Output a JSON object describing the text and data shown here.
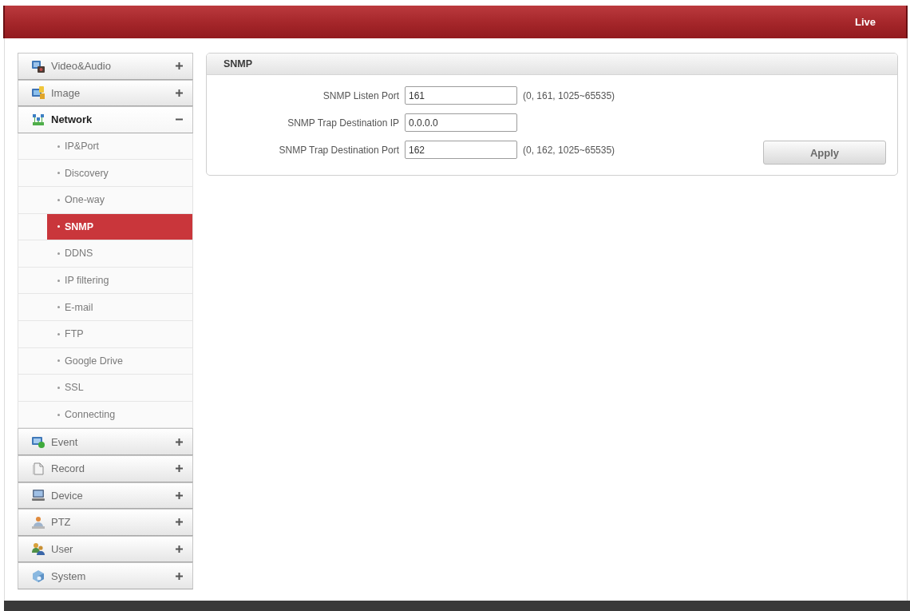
{
  "header": {
    "live_link": "Live"
  },
  "sidebar": {
    "items": [
      {
        "label": "Video&Audio",
        "selected": false,
        "expanded": false
      },
      {
        "label": "Image",
        "selected": false,
        "expanded": false
      },
      {
        "label": "Network",
        "selected": true,
        "expanded": true,
        "children": [
          {
            "label": "IP&Port",
            "selected": false
          },
          {
            "label": "Discovery",
            "selected": false
          },
          {
            "label": "One-way",
            "selected": false
          },
          {
            "label": "SNMP",
            "selected": true
          },
          {
            "label": "DDNS",
            "selected": false
          },
          {
            "label": "IP filtering",
            "selected": false
          },
          {
            "label": "E-mail",
            "selected": false
          },
          {
            "label": "FTP",
            "selected": false
          },
          {
            "label": "Google Drive",
            "selected": false
          },
          {
            "label": "SSL",
            "selected": false
          },
          {
            "label": "Connecting",
            "selected": false
          }
        ]
      },
      {
        "label": "Event",
        "selected": false,
        "expanded": false
      },
      {
        "label": "Record",
        "selected": false,
        "expanded": false
      },
      {
        "label": "Device",
        "selected": false,
        "expanded": false
      },
      {
        "label": "PTZ",
        "selected": false,
        "expanded": false
      },
      {
        "label": "User",
        "selected": false,
        "expanded": false
      },
      {
        "label": "System",
        "selected": false,
        "expanded": false
      }
    ]
  },
  "panel": {
    "title": "SNMP",
    "fields": [
      {
        "label": "SNMP Listen Port",
        "value": "161",
        "hint": "(0, 161, 1025~65535)"
      },
      {
        "label": "SNMP Trap Destination IP",
        "value": "0.0.0.0"
      },
      {
        "label": "SNMP Trap Destination Port",
        "value": "162",
        "hint": "(0, 162, 1025~65535)"
      }
    ],
    "apply_button": "Apply"
  }
}
